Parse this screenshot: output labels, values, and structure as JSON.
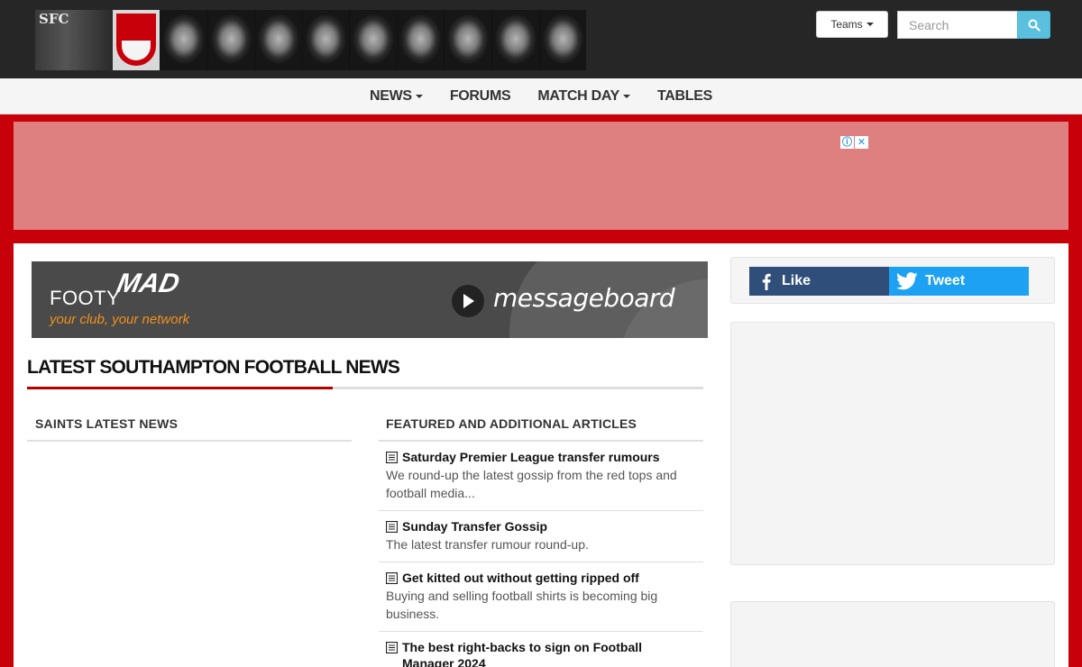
{
  "header": {
    "banner_text": "SFC",
    "teams_label": "Teams",
    "search": {
      "placeholder": "Search",
      "value": ""
    }
  },
  "nav": {
    "items": [
      {
        "label": "NEWS",
        "dropdown": true
      },
      {
        "label": "FORUMS",
        "dropdown": false
      },
      {
        "label": "MATCH DAY",
        "dropdown": true
      },
      {
        "label": "TABLES",
        "dropdown": false
      }
    ]
  },
  "ad": {
    "info_icon": "ⓘ",
    "close_icon": "✕"
  },
  "messageboard": {
    "brand_a": "FOOTY",
    "brand_b": "MAD",
    "tagline": "your club, your network",
    "label": "messageboard"
  },
  "section": {
    "title": "LATEST SOUTHAMPTON FOOTBALL NEWS"
  },
  "columns": {
    "left_heading": "SAINTS LATEST NEWS",
    "right_heading": "FEATURED AND ADDITIONAL ARTICLES"
  },
  "articles": [
    {
      "title": "Saturday Premier League transfer rumours",
      "desc": "We round-up the latest gossip from the red tops and football media..."
    },
    {
      "title": "Sunday Transfer Gossip",
      "desc": "The latest transfer rumour round-up."
    },
    {
      "title": "Get kitted out without getting ripped off",
      "desc": "Buying and selling football shirts is becoming big business."
    },
    {
      "title": "The best right-backs to sign on Football Manager 2024",
      "desc": ""
    }
  ],
  "social": {
    "like_label": "Like",
    "tweet_label": "Tweet"
  },
  "colors": {
    "brand_red": "#c8000a",
    "header_dark": "#262626",
    "facebook": "#2f4f7a",
    "twitter": "#1da1f2",
    "search_button": "#5bc0de"
  }
}
